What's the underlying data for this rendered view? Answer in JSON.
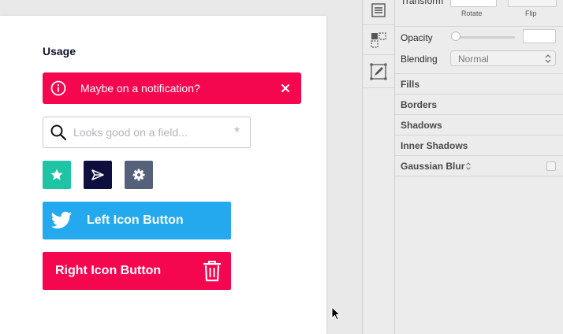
{
  "colors": {
    "notification": "#f5074f",
    "teal": "#1fc4a4",
    "navy": "#0f0f3f",
    "slate": "#55607a",
    "twitter": "#24a9ef",
    "danger": "#f5074f"
  },
  "canvas": {
    "usage_title": "Usage",
    "notification": {
      "text": "Maybe on a notification?",
      "icon": "info-icon",
      "close_icon": "close-icon"
    },
    "field": {
      "placeholder": "Looks good on a field...",
      "value": "",
      "icon": "search-icon",
      "marker": "*"
    },
    "icon_buttons": [
      {
        "icon": "star-icon",
        "color": "teal"
      },
      {
        "icon": "send-icon",
        "color": "navy"
      },
      {
        "icon": "gear-icon",
        "color": "slate"
      }
    ],
    "left_icon_button": {
      "label": "Left Icon Button",
      "icon": "twitter-icon"
    },
    "right_icon_button": {
      "label": "Right Icon Button",
      "icon": "trash-icon"
    }
  },
  "toolbar": {
    "tools": [
      "list-icon",
      "frame-icon",
      "edit-icon"
    ]
  },
  "inspector": {
    "transform_label": "Transform",
    "rotate_label": "Rotate",
    "flip_label": "Flip",
    "opacity_label": "Opacity",
    "opacity_value": "",
    "blending_label": "Blending",
    "blending_value": "Normal",
    "sections": {
      "fills": "Fills",
      "borders": "Borders",
      "shadows": "Shadows",
      "inner_shadows": "Inner Shadows",
      "gaussian_blur": "Gaussian Blur"
    }
  }
}
